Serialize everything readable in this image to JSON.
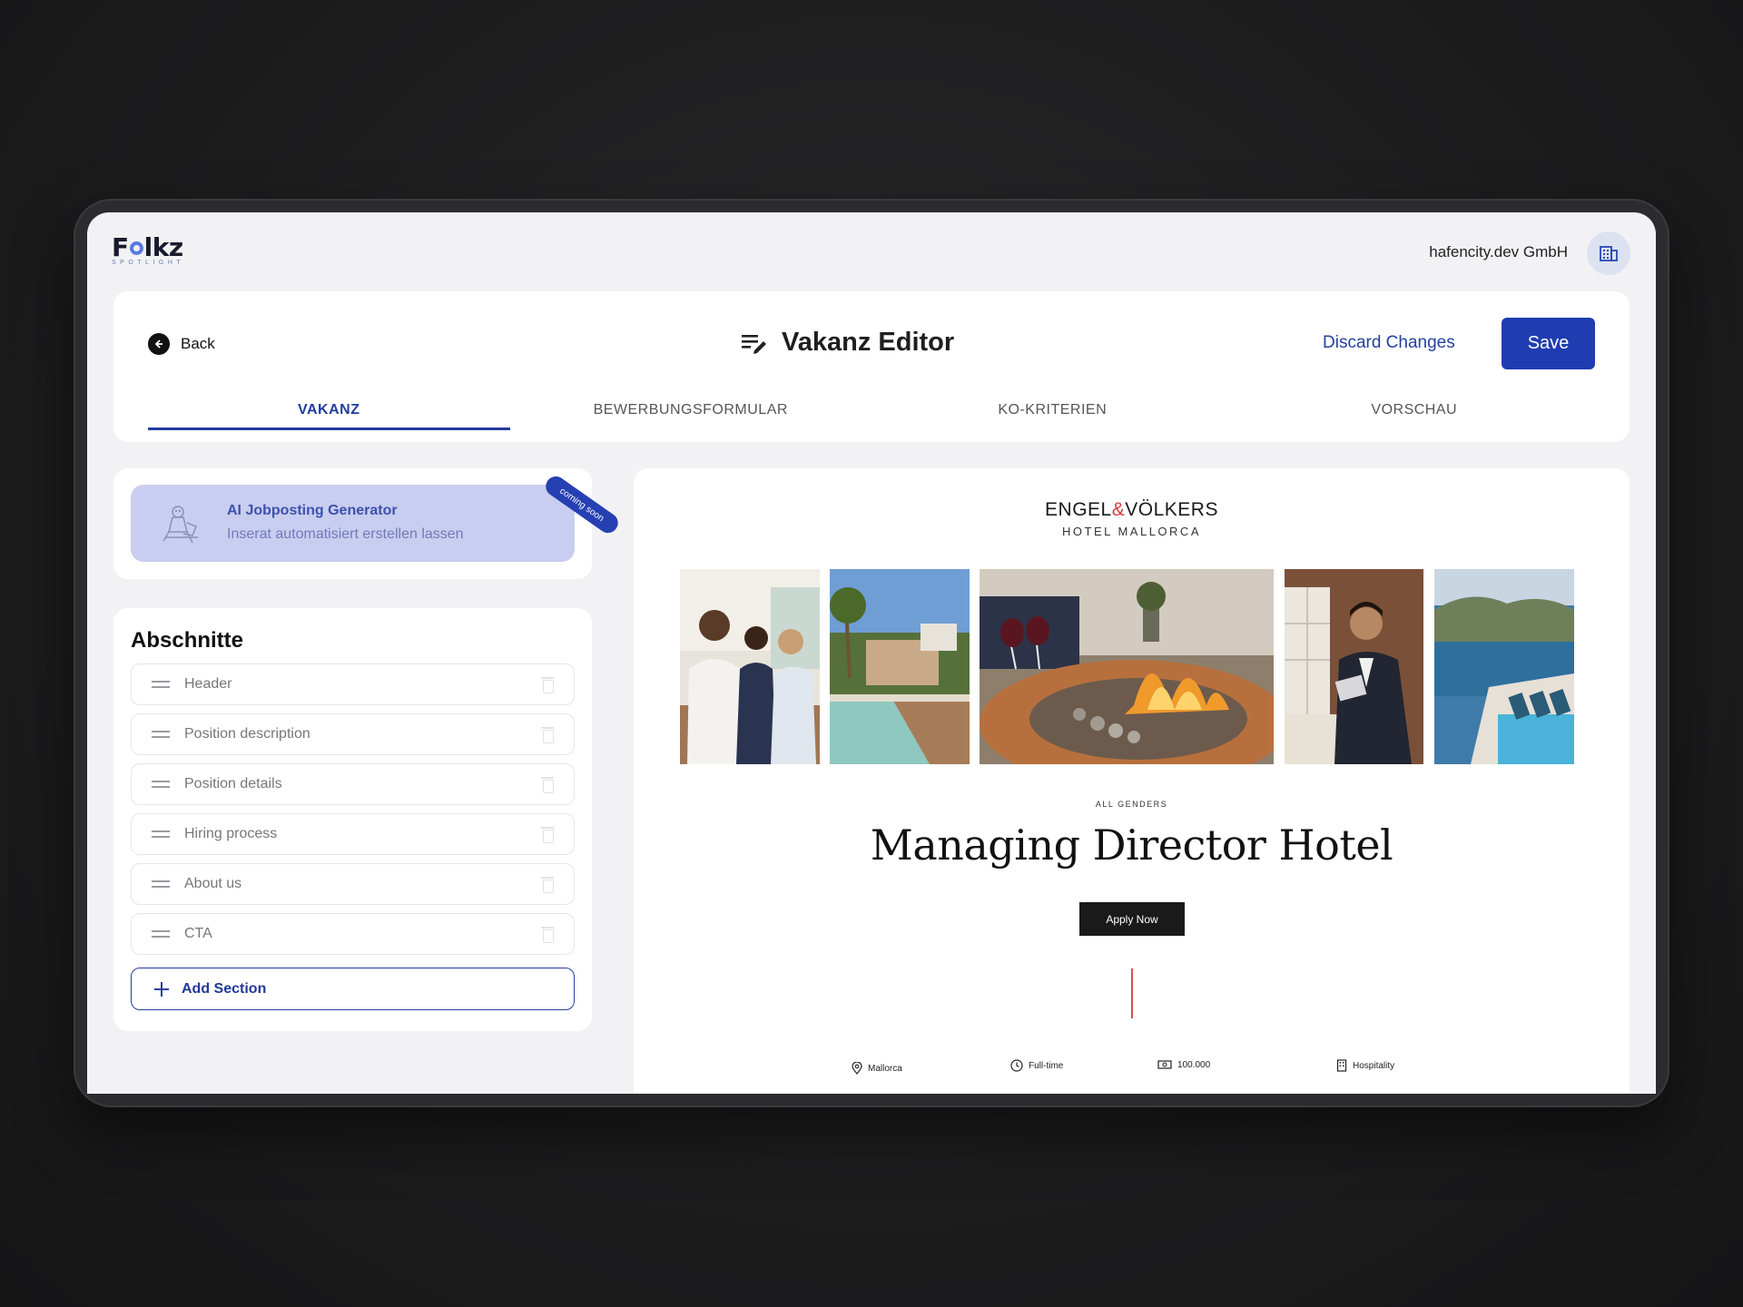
{
  "app": {
    "logo_text_prefix": "F",
    "logo_text_suffix": "lkz",
    "logo_subtitle": "SPOTLIGHT",
    "company": "hafencity.dev GmbH"
  },
  "header": {
    "back_label": "Back",
    "title": "Vakanz Editor",
    "discard_label": "Discard Changes",
    "save_label": "Save",
    "tabs": [
      {
        "label": "VAKANZ",
        "active": true
      },
      {
        "label": "BEWERBUNGSFORMULAR",
        "active": false
      },
      {
        "label": "KO-KRITERIEN",
        "active": false
      },
      {
        "label": "VORSCHAU",
        "active": false
      }
    ]
  },
  "ai_card": {
    "title": "AI Jobposting Generator",
    "subtitle": "Inserat automatisiert erstellen lassen",
    "badge": "coming soon"
  },
  "sections": {
    "title": "Abschnitte",
    "items": [
      {
        "label": "Header"
      },
      {
        "label": "Position description"
      },
      {
        "label": "Position details"
      },
      {
        "label": "Hiring process"
      },
      {
        "label": "About us"
      },
      {
        "label": "CTA"
      }
    ],
    "add_label": "Add Section"
  },
  "preview": {
    "brand_part1": "ENGEL",
    "brand_amp": "&",
    "brand_part2": "VÖLKERS",
    "brand_sub": "HOTEL MALLORCA",
    "gender_label": "ALL GENDERS",
    "job_title": "Managing Director Hotel",
    "apply_label": "Apply Now",
    "meta": [
      {
        "icon": "location-pin-icon",
        "label": "Mallorca"
      },
      {
        "icon": "clock-icon",
        "label": "Full-time"
      },
      {
        "icon": "money-icon",
        "label": "100.000"
      },
      {
        "icon": "building-icon",
        "label": "Hospitality"
      }
    ]
  },
  "colors": {
    "primary": "#1f3db0",
    "ai_card_bg": "#c9cdef",
    "accent_red": "#d23d3d"
  }
}
